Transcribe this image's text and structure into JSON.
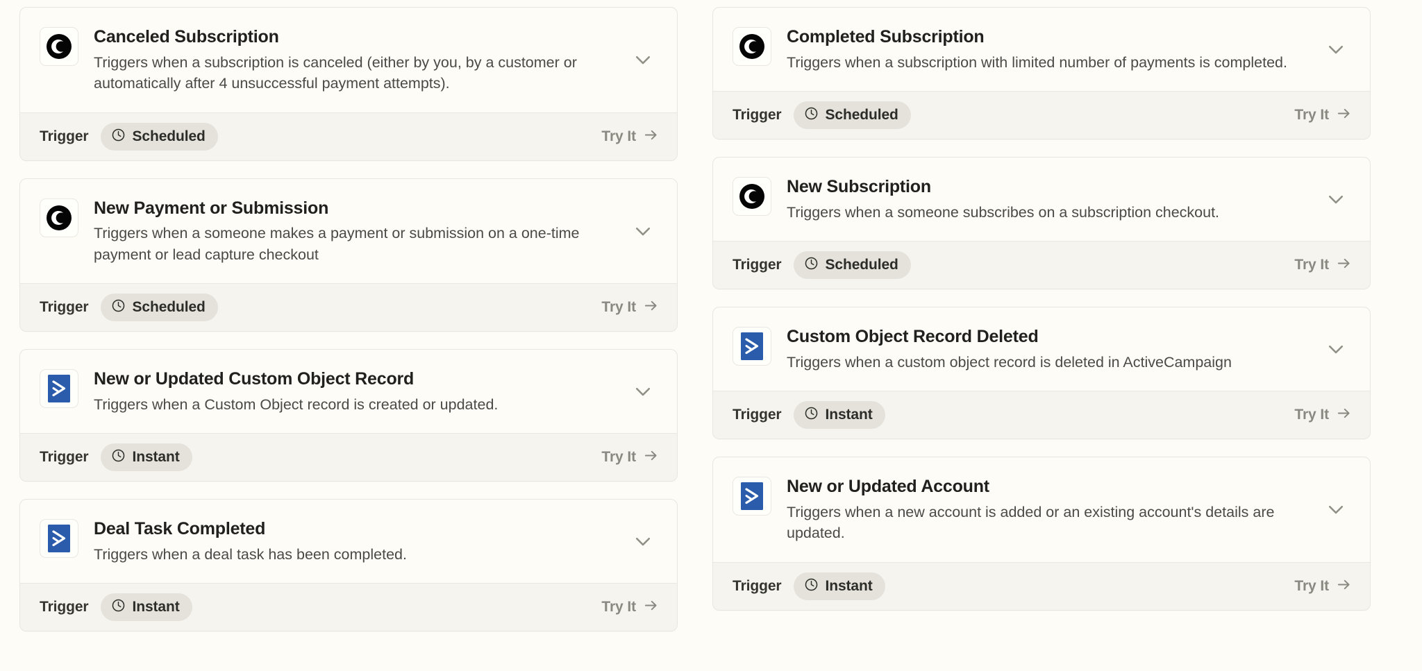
{
  "theme": {
    "page_background": "#FDFCF6",
    "card_background": "#FDFCF6",
    "card_border": "#E8E6DE",
    "footer_background": "#F5F4EF",
    "badge_background": "#E4E2DB",
    "title_color": "#20201E",
    "description_color": "#4A4A46",
    "try_it_color": "#8A8981",
    "activecampaign_blue": "#2B5CAB",
    "checkout_black": "#050505"
  },
  "columns": [
    {
      "id": "left-column",
      "cards": [
        {
          "title": "Canceled Subscription",
          "description": "Triggers when a subscription is canceled (either by you, by a customer or automatically after 4 unsuccessful payment attempts).",
          "app_icon": "checkout-page-icon",
          "chevron_icon": "chevron-down-icon",
          "footer_label": "Trigger",
          "badge_icon": "clock-icon",
          "badge_text": "Scheduled",
          "try_it_label": "Try It",
          "try_it_icon": "arrow-right-icon"
        },
        {
          "title": "New Payment or Submission",
          "description": "Triggers when a someone makes a payment or submission on a one-time payment or lead capture checkout",
          "app_icon": "checkout-page-icon",
          "chevron_icon": "chevron-down-icon",
          "footer_label": "Trigger",
          "badge_icon": "clock-icon",
          "badge_text": "Scheduled",
          "try_it_label": "Try It",
          "try_it_icon": "arrow-right-icon"
        },
        {
          "title": "New or Updated Custom Object Record",
          "description": "Triggers when a Custom Object record is created or updated.",
          "app_icon": "activecampaign-icon",
          "chevron_icon": "chevron-down-icon",
          "footer_label": "Trigger",
          "badge_icon": "clock-icon",
          "badge_text": "Instant",
          "try_it_label": "Try It",
          "try_it_icon": "arrow-right-icon"
        },
        {
          "title": "Deal Task Completed",
          "description": "Triggers when a deal task has been completed.",
          "app_icon": "activecampaign-icon",
          "chevron_icon": "chevron-down-icon",
          "footer_label": "Trigger",
          "badge_icon": "clock-icon",
          "badge_text": "Instant",
          "try_it_label": "Try It",
          "try_it_icon": "arrow-right-icon"
        }
      ]
    },
    {
      "id": "right-column",
      "cards": [
        {
          "title": "Completed Subscription",
          "description": "Triggers when a subscription with limited number of payments is completed.",
          "app_icon": "checkout-page-icon",
          "chevron_icon": "chevron-down-icon",
          "footer_label": "Trigger",
          "badge_icon": "clock-icon",
          "badge_text": "Scheduled",
          "try_it_label": "Try It",
          "try_it_icon": "arrow-right-icon"
        },
        {
          "title": "New Subscription",
          "description": "Triggers when a someone subscribes on a subscription checkout.",
          "app_icon": "checkout-page-icon",
          "chevron_icon": "chevron-down-icon",
          "footer_label": "Trigger",
          "badge_icon": "clock-icon",
          "badge_text": "Scheduled",
          "try_it_label": "Try It",
          "try_it_icon": "arrow-right-icon"
        },
        {
          "title": "Custom Object Record Deleted",
          "description": "Triggers when a custom object record is deleted in ActiveCampaign",
          "app_icon": "activecampaign-icon",
          "chevron_icon": "chevron-down-icon",
          "footer_label": "Trigger",
          "badge_icon": "clock-icon",
          "badge_text": "Instant",
          "try_it_label": "Try It",
          "try_it_icon": "arrow-right-icon"
        },
        {
          "title": "New or Updated Account",
          "description": "Triggers when a new account is added or an existing account's details are updated.",
          "app_icon": "activecampaign-icon",
          "chevron_icon": "chevron-down-icon",
          "footer_label": "Trigger",
          "badge_icon": "clock-icon",
          "badge_text": "Instant",
          "try_it_label": "Try It",
          "try_it_icon": "arrow-right-icon"
        }
      ]
    }
  ]
}
